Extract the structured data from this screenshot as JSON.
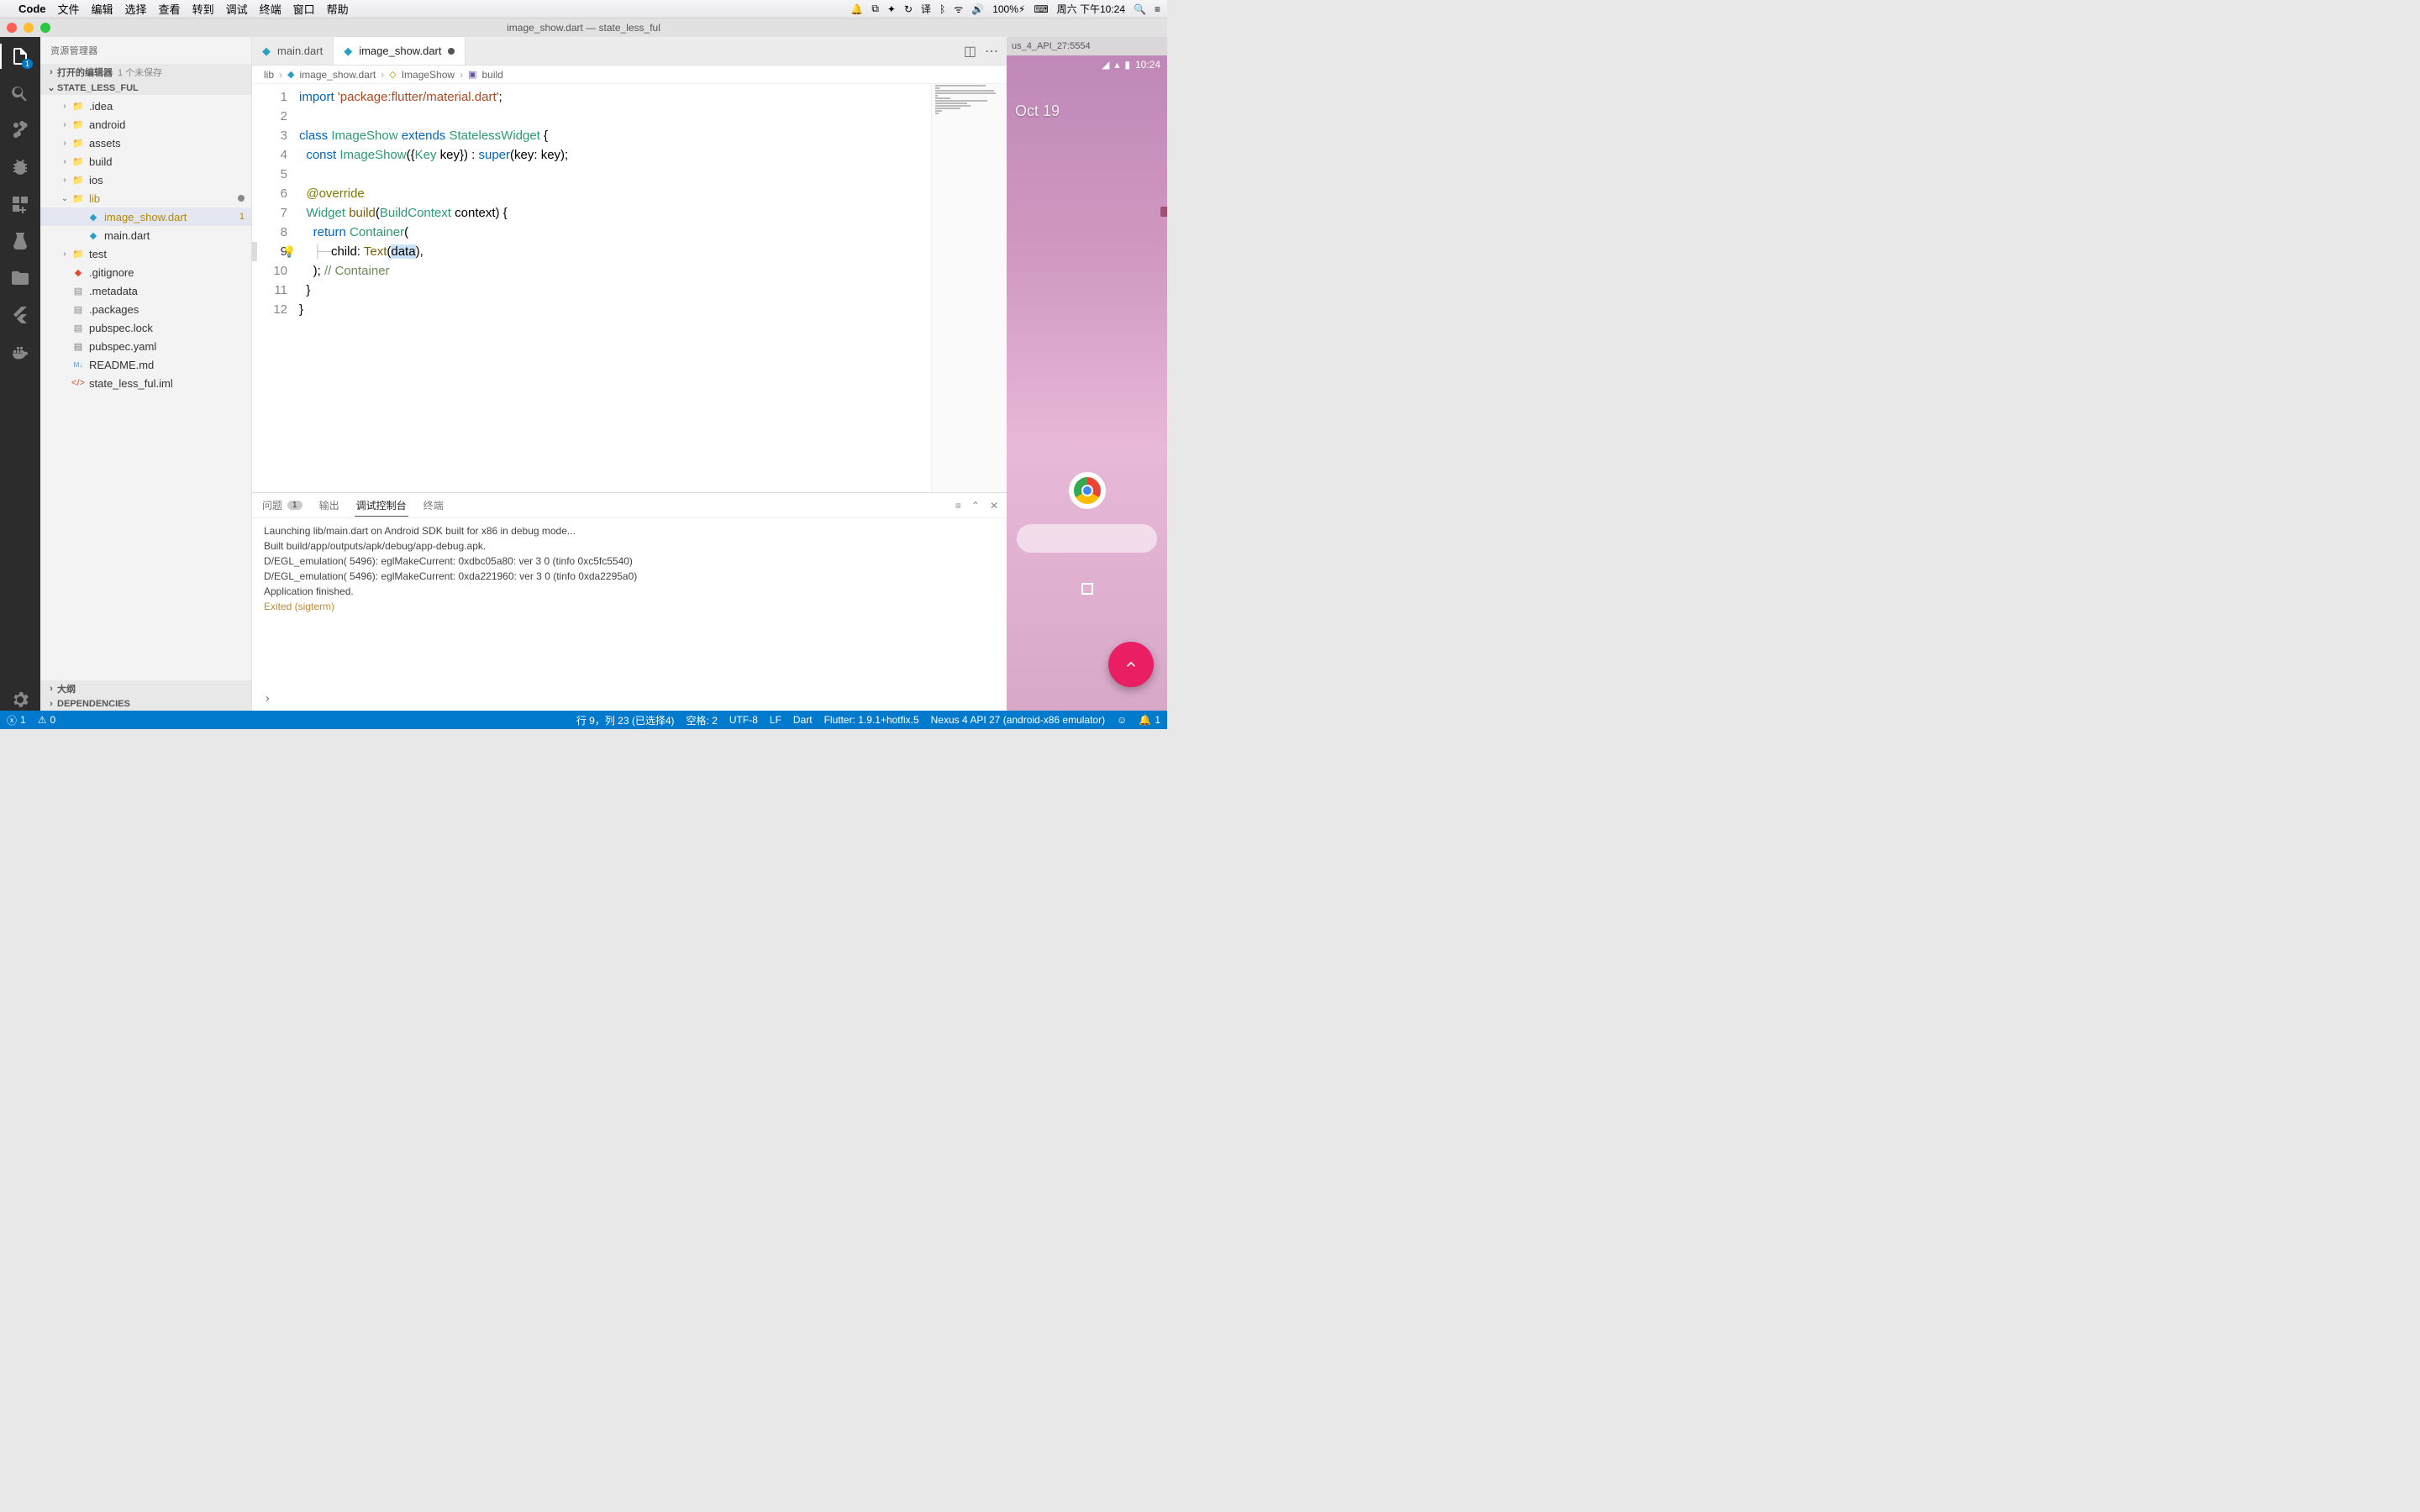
{
  "menubar": {
    "apple": "",
    "app": "Code",
    "items": [
      "文件",
      "编辑",
      "选择",
      "查看",
      "转到",
      "调试",
      "终端",
      "窗口",
      "帮助"
    ],
    "battery": "100%",
    "datetime": "周六 下午10:24"
  },
  "titlebar": {
    "title": "image_show.dart — state_less_ful"
  },
  "sidebar": {
    "header": "资源管理器",
    "open_editors_label": "打开的编辑器",
    "unsaved": "1 个未保存",
    "project": "STATE_LESS_FUL",
    "tree": [
      {
        "chev": "›",
        "icon": "folder",
        "label": ".idea",
        "indent": 22
      },
      {
        "chev": "›",
        "icon": "folder",
        "label": "android",
        "indent": 22
      },
      {
        "chev": "›",
        "icon": "folder",
        "label": "assets",
        "indent": 22
      },
      {
        "chev": "›",
        "icon": "folder",
        "label": "build",
        "indent": 22
      },
      {
        "chev": "›",
        "icon": "folder",
        "label": "ios",
        "indent": 22
      },
      {
        "chev": "⌄",
        "icon": "folder",
        "label": "lib",
        "indent": 22,
        "warn": true,
        "dot": true
      },
      {
        "chev": "",
        "icon": "dart",
        "label": "image_show.dart",
        "indent": 40,
        "selected": true,
        "warn": true,
        "num": "1"
      },
      {
        "chev": "",
        "icon": "dart",
        "label": "main.dart",
        "indent": 40
      },
      {
        "chev": "›",
        "icon": "folder",
        "label": "test",
        "indent": 22
      },
      {
        "chev": "",
        "icon": "git",
        "label": ".gitignore",
        "indent": 22
      },
      {
        "chev": "",
        "icon": "file",
        "label": ".metadata",
        "indent": 22
      },
      {
        "chev": "",
        "icon": "file",
        "label": ".packages",
        "indent": 22
      },
      {
        "chev": "",
        "icon": "file",
        "label": "pubspec.lock",
        "indent": 22
      },
      {
        "chev": "",
        "icon": "yaml",
        "label": "pubspec.yaml",
        "indent": 22
      },
      {
        "chev": "",
        "icon": "md",
        "label": "README.md",
        "indent": 22
      },
      {
        "chev": "",
        "icon": "xml",
        "label": "state_less_ful.iml",
        "indent": 22
      }
    ],
    "outline": "大纲",
    "dependencies": "DEPENDENCIES"
  },
  "tabs": {
    "items": [
      {
        "icon": "dart",
        "label": "main.dart",
        "active": false
      },
      {
        "icon": "dart",
        "label": "image_show.dart",
        "active": true,
        "dirty": true
      }
    ]
  },
  "breadcrumb": {
    "parts": [
      "lib",
      "image_show.dart",
      "ImageShow",
      "build"
    ]
  },
  "code": {
    "lines": [
      {
        "n": 1,
        "html": "<span class='tk-keyword'>import</span> <span class='tk-string'>'package:flutter/material.dart'</span>;"
      },
      {
        "n": 2,
        "html": ""
      },
      {
        "n": 3,
        "html": "<span class='tk-keyword'>class</span> <span class='tk-type'>ImageShow</span> <span class='tk-keyword'>extends</span> <span class='tk-type'>StatelessWidget</span> {"
      },
      {
        "n": 4,
        "html": "  <span class='tk-keyword'>const</span> <span class='tk-type'>ImageShow</span>({<span class='tk-type'>Key</span> key}) : <span class='tk-keyword'>super</span>(key: key);"
      },
      {
        "n": 5,
        "html": ""
      },
      {
        "n": 6,
        "html": "  <span class='tk-anno'>@override</span>"
      },
      {
        "n": 7,
        "html": "  <span class='tk-type'>Widget</span> <span class='tk-func'>build</span>(<span class='tk-type'>BuildContext</span> context) {"
      },
      {
        "n": 8,
        "html": "    <span class='tk-keyword'>return</span> <span class='tk-type'>Container</span>("
      },
      {
        "n": 9,
        "html": "    <span class='tree-guide'>├─</span>child: <span class='tk-func'>Text</span>(<span class='selected-text'>data</span>),",
        "current": true,
        "bulb": true
      },
      {
        "n": 10,
        "html": "    ); <span class='tk-comment'>// Container</span>"
      },
      {
        "n": 11,
        "html": "  }"
      },
      {
        "n": 12,
        "html": "}"
      }
    ]
  },
  "panel": {
    "tabs": {
      "problems": "问题",
      "problems_count": "1",
      "output": "输出",
      "debug": "调试控制台",
      "terminal": "终端"
    },
    "lines": [
      "Launching lib/main.dart on Android SDK built for x86 in debug mode...",
      "Built build/app/outputs/apk/debug/app-debug.apk.",
      "D/EGL_emulation( 5496): eglMakeCurrent: 0xdbc05a80: ver 3 0 (tinfo 0xc5fc5540)",
      "D/EGL_emulation( 5496): eglMakeCurrent: 0xda221960: ver 3 0 (tinfo 0xda2295a0)",
      "Application finished."
    ],
    "exited": "Exited (sigterm)",
    "prompt": "›"
  },
  "status": {
    "errors": "1",
    "warnings": "0",
    "cursor": "行 9，列 23 (已选择4)",
    "spaces": "空格: 2",
    "encoding": "UTF-8",
    "eol": "LF",
    "lang": "Dart",
    "flutter": "Flutter: 1.9.1+hotfix.5",
    "device": "Nexus 4 API 27 (android-x86 emulator)",
    "bell": "1"
  },
  "emulator": {
    "title": "us_4_API_27:5554",
    "time": "10:24",
    "date": "Oct 19"
  }
}
